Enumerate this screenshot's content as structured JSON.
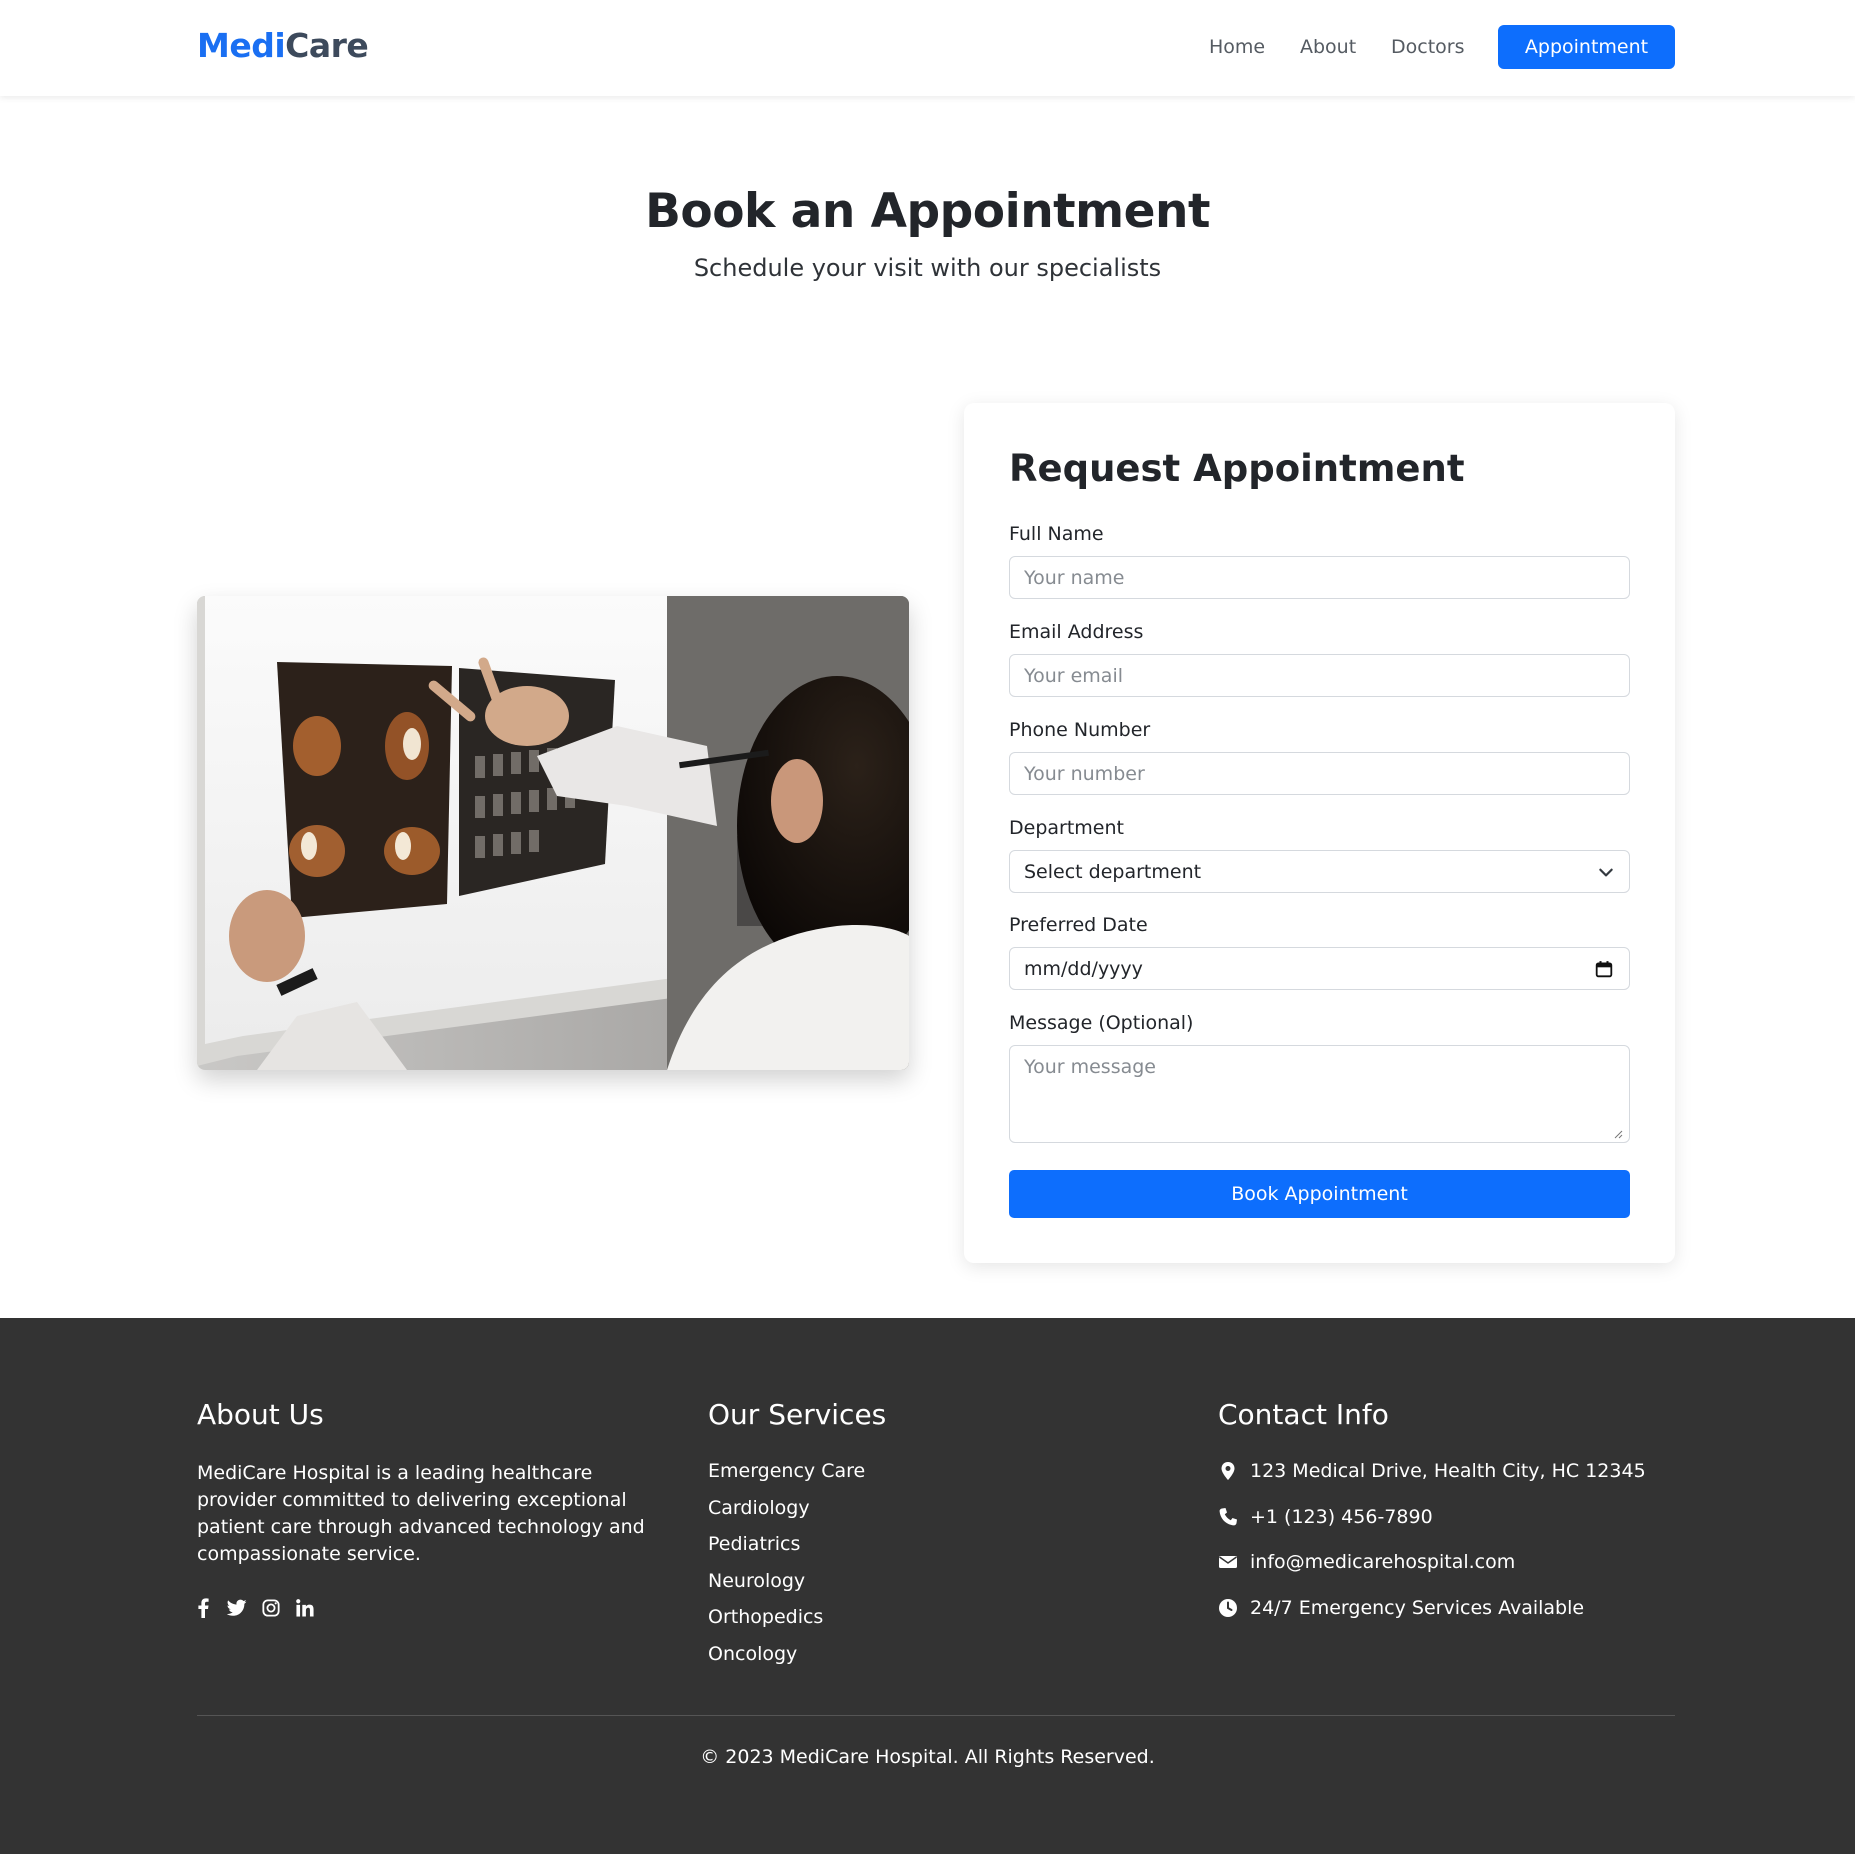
{
  "brand": {
    "part1": "Medi",
    "part2": "Care"
  },
  "nav": {
    "links": [
      "Home",
      "About",
      "Doctors"
    ],
    "cta": "Appointment"
  },
  "hero": {
    "title": "Book an Appointment",
    "subtitle": "Schedule your visit with our specialists"
  },
  "form": {
    "title": "Request Appointment",
    "full_name": {
      "label": "Full Name",
      "placeholder": "Your name"
    },
    "email": {
      "label": "Email Address",
      "placeholder": "Your email"
    },
    "phone": {
      "label": "Phone Number",
      "placeholder": "Your number"
    },
    "department": {
      "label": "Department",
      "selected": "Select department"
    },
    "date": {
      "label": "Preferred Date",
      "value": "mm/dd/yyyy"
    },
    "message": {
      "label": "Message (Optional)",
      "placeholder": "Your message"
    },
    "submit": "Book Appointment"
  },
  "footer": {
    "about": {
      "title": "About Us",
      "text": "MediCare Hospital is a leading healthcare provider committed to delivering exceptional patient care through advanced technology and compassionate service."
    },
    "services": {
      "title": "Our Services",
      "items": [
        "Emergency Care",
        "Cardiology",
        "Pediatrics",
        "Neurology",
        "Orthopedics",
        "Oncology"
      ]
    },
    "contact": {
      "title": "Contact Info",
      "address": "123 Medical Drive, Health City, HC 12345",
      "phone": "+1 (123) 456-7890",
      "email": "info@medicarehospital.com",
      "hours": "24/7 Emergency Services Available"
    },
    "copyright": "© 2023 MediCare Hospital. All Rights Reserved."
  },
  "colors": {
    "primary": "#0d6efd",
    "brand_blue": "#1a6ff2",
    "brand_gray": "#3d4a5c",
    "footer_bg": "#333333"
  },
  "icons": {
    "social": [
      "facebook-icon",
      "twitter-icon",
      "instagram-icon",
      "linkedin-icon"
    ],
    "contact": [
      "map-pin-icon",
      "phone-icon",
      "envelope-icon",
      "clock-icon"
    ]
  }
}
